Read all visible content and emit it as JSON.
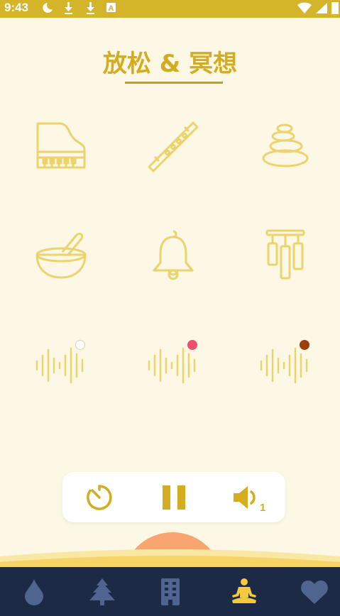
{
  "status_bar": {
    "time": "9:43",
    "icons": [
      "moon-icon",
      "download-icon",
      "download-icon",
      "a-badge-icon",
      "wifi-icon",
      "signal-icon",
      "battery-icon"
    ]
  },
  "page": {
    "title": "放松 & 冥想"
  },
  "sounds": [
    {
      "name": "piano-icon",
      "row": 1
    },
    {
      "name": "flute-icon",
      "row": 1
    },
    {
      "name": "zen-stones-icon",
      "row": 1
    },
    {
      "name": "mortar-bowl-icon",
      "row": 2
    },
    {
      "name": "bell-icon",
      "row": 2
    },
    {
      "name": "wind-chimes-icon",
      "row": 2
    }
  ],
  "noises": [
    {
      "name": "white-noise",
      "dot_color": "#ffffff"
    },
    {
      "name": "pink-noise",
      "dot_color": "#ef4f6e"
    },
    {
      "name": "brown-noise",
      "dot_color": "#9b3f0e"
    }
  ],
  "controls": {
    "timer": "timer-icon",
    "playback": "pause-icon",
    "volume": "volume-icon",
    "volume_count": "1"
  },
  "nav": {
    "items": [
      "water-drop-icon",
      "tree-icon",
      "building-icon",
      "meditation-icon",
      "heart-icon"
    ],
    "active": "meditation-icon"
  },
  "colors": {
    "accent": "#d4ac1f",
    "icon_stroke": "#ecd36b",
    "background": "#fdf8e6",
    "nav_bg": "#1c2a45",
    "nav_inactive": "#4f6590",
    "nav_active": "#f6c93d",
    "sun": "#f8a56f"
  }
}
